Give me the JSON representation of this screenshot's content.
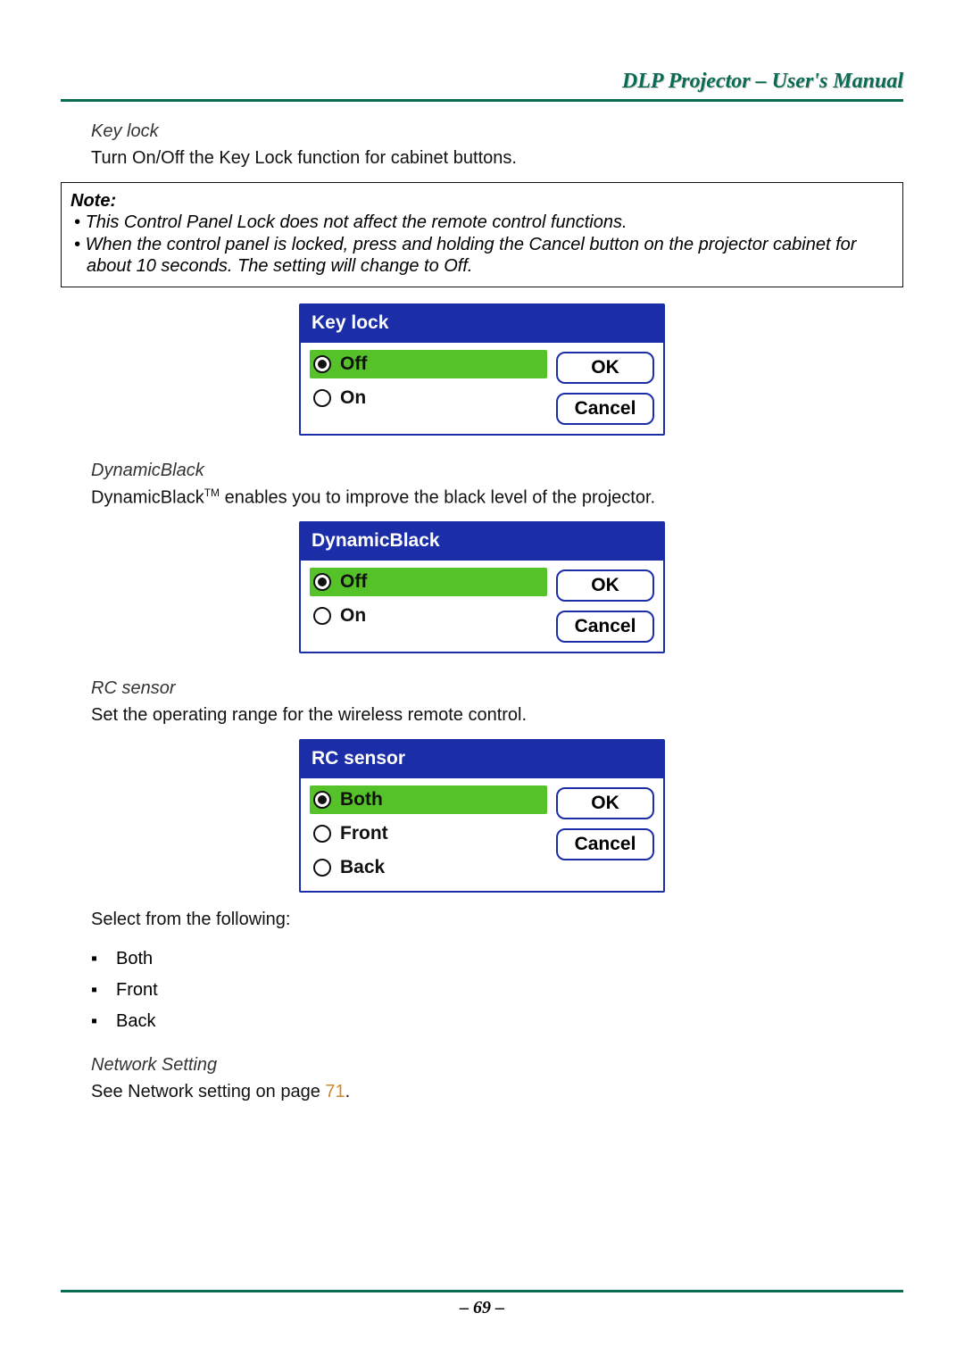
{
  "header": {
    "title": "DLP Projector – User's Manual"
  },
  "sections": {
    "keylock": {
      "heading": "Key lock",
      "text": "Turn On/Off the Key Lock function for cabinet buttons."
    },
    "note": {
      "label": "Note:",
      "line1": "This Control Panel Lock does not affect the remote control functions.",
      "line2a": "When the control panel is locked, press and holding the Cancel button on the projector cabinet for",
      "line2b": "about 10 seconds. The setting will change to Off."
    },
    "dynamicblack": {
      "heading": "DynamicBlack",
      "text_a": "DynamicBlack",
      "text_sup": "TM",
      "text_b": " enables you to improve the black level of the projector."
    },
    "rcsensor": {
      "heading": "RC sensor",
      "text": "Set the operating range for the wireless remote control.",
      "select_text": "Select from the following:",
      "items": [
        "Both",
        "Front",
        "Back"
      ]
    },
    "network": {
      "heading": "Network Setting",
      "text_a": "See Network setting on page ",
      "link": "71",
      "text_b": "."
    }
  },
  "dialogs": {
    "keylock": {
      "title": "Key lock",
      "options": [
        "Off",
        "On"
      ],
      "selected_index": 0
    },
    "dynamicblack": {
      "title": "DynamicBlack",
      "options": [
        "Off",
        "On"
      ],
      "selected_index": 0
    },
    "rcsensor": {
      "title": "RC sensor",
      "options": [
        "Both",
        "Front",
        "Back"
      ],
      "selected_index": 0
    },
    "buttons": {
      "ok": "OK",
      "cancel": "Cancel"
    }
  },
  "footer": {
    "page": "– 69 –"
  }
}
